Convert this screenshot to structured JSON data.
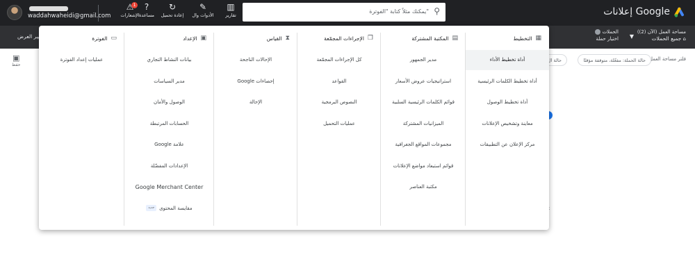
{
  "header": {
    "email": "waddahwaheidi@gmail.com",
    "brand_title": "إعلانات Google",
    "search_placeholder": "يمكنك مثلاً كتابة \"الفوترة\"",
    "tools": [
      {
        "icon": "reports-icon",
        "glyph": "▥",
        "label": "تقارير"
      },
      {
        "icon": "wrench-icon",
        "glyph": "🔧",
        "label": "الأدوات وال"
      },
      {
        "icon": "refresh-icon",
        "glyph": "↻",
        "label": "إعادة تحميل"
      },
      {
        "icon": "help-icon",
        "glyph": "?",
        "label": "مساعدة"
      },
      {
        "icon": "bell-icon",
        "glyph": "🔔",
        "label": "الإشعارات",
        "badge": "1"
      }
    ]
  },
  "subbar": {
    "account_line1": "مساحة العمل (الآن (2))",
    "account_line2": "جميع الحملات",
    "campaigns_line1": "الحملات",
    "campaigns_line2": "اختيار حملة",
    "change_view": "تغيير العرض"
  },
  "page": {
    "save_label": "حفظ",
    "filter_label": "فلتر مساحة العمل",
    "chip1": "حالة الحملة: مفعّلة، متوقفة مؤقتًا",
    "chip2": "حالة ال"
  },
  "menu": {
    "columns": [
      {
        "key": "planning",
        "title": "التخطيط",
        "icon": "calendar-icon",
        "glyph": "▦",
        "items": [
          "أداة تخطيط الأداء",
          "أداة تخطيط الكلمات الرئيسية",
          "أداة تخطيط الوصول",
          "معاينة وتشخيص الإعلانات",
          "مركز الإعلان عن التطبيقات"
        ],
        "active_index": 0
      },
      {
        "key": "shared-library",
        "title": "المكتبة المشتركة",
        "icon": "library-icon",
        "glyph": "▤",
        "items": [
          "مدير الجمهور",
          "استراتيجيات عروض الأسعار",
          "قوائم الكلمات الرئيسية السلبية",
          "الميزانيات المشتركة",
          "مجموعات المواقع الجغرافية",
          "قوائم استبعاد مواضع الإعلانات",
          "مكتبة العناصر"
        ]
      },
      {
        "key": "bulk-actions",
        "title": "الإجراءات المجمّعة",
        "icon": "copy-icon",
        "glyph": "❐",
        "items": [
          "كل الإجراءات المجمّعة",
          "القواعد",
          "النصوص البرمجية",
          "عمليات التحميل"
        ]
      },
      {
        "key": "measurement",
        "title": "القياس",
        "icon": "hourglass-icon",
        "glyph": "⧗",
        "items": [
          "الإحالات الناجحة",
          "إحصاءات Google",
          "الإحالة"
        ]
      },
      {
        "key": "setup",
        "title": "الإعداد",
        "icon": "setup-icon",
        "glyph": "▣",
        "items": [
          "بيانات النشاط التجاري",
          "مدير السياسات",
          "الوصول والأمان",
          "الحسابات المرتبطة",
          "علامة Google",
          "الإعدادات المفضّلة",
          "Google Merchant Center",
          "مقايسة المحتوى"
        ],
        "tag_item_index": 7,
        "tag": "جديد"
      },
      {
        "key": "billing",
        "title": "الفوترة",
        "icon": "credit-card-icon",
        "glyph": "▭",
        "items": [
          "عمليات إعداد الفوترة"
        ]
      }
    ]
  }
}
